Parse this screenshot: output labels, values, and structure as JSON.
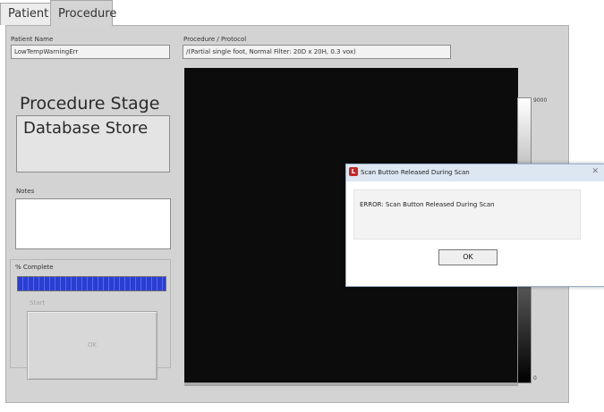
{
  "tabs": [
    {
      "label": "Patient",
      "active": false
    },
    {
      "label": "Procedure",
      "active": true
    }
  ],
  "patient": {
    "name_label": "Patient Name",
    "name_value": "LowTempWarningErr"
  },
  "protocol": {
    "label": "Procedure / Protocol",
    "value": "/(Partial single foot, Normal Filter: 20D x 20H, 0.3 vox)"
  },
  "stage": {
    "title": "Procedure Stage",
    "value": "Database Store"
  },
  "notes": {
    "label": "Notes",
    "value": ""
  },
  "progress": {
    "label": "% Complete",
    "percent": 100,
    "color": "#2a3ed1"
  },
  "start": {
    "label": "Start",
    "button_label": "OK"
  },
  "scale": {
    "max_label": "9000",
    "min_label": "0"
  },
  "dialog": {
    "title": "Scan Button Released During Scan",
    "icon": "app-error-icon",
    "close_glyph": "✕",
    "message": "ERROR: Scan Button Released During Scan",
    "ok_label": "OK"
  }
}
